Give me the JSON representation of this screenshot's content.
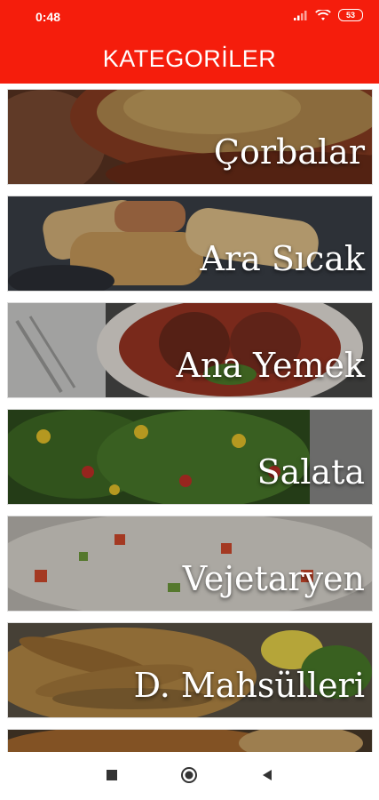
{
  "status_bar": {
    "time": "0:48",
    "battery": "53",
    "icons": [
      "signal-icon",
      "wifi-icon",
      "battery-icon"
    ]
  },
  "app_bar": {
    "title": "KATEGORİLER",
    "color": "#f51d0c"
  },
  "categories": [
    {
      "label": "Çorbalar"
    },
    {
      "label": "Ara Sıcak"
    },
    {
      "label": "Ana Yemek"
    },
    {
      "label": "Salata"
    },
    {
      "label": "Vejetaryen"
    },
    {
      "label": "D. Mahsülleri"
    },
    {
      "label": ""
    }
  ],
  "nav_bar": {
    "icons": [
      "recent-apps-icon",
      "home-icon",
      "back-icon"
    ]
  }
}
